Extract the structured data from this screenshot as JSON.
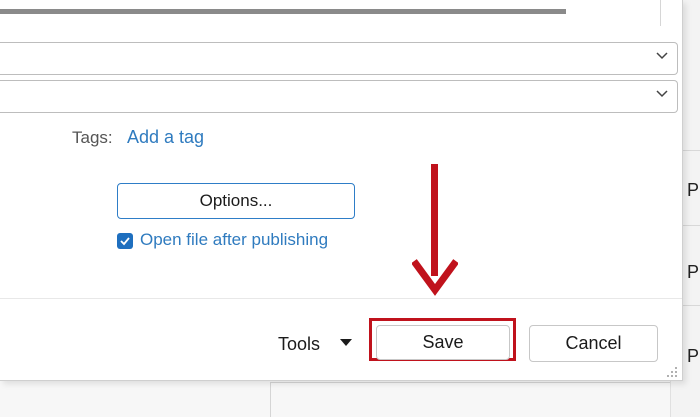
{
  "dialog": {
    "tags": {
      "label": "Tags:",
      "link": "Add a tag"
    },
    "options_button": "Options...",
    "open_after_publishing": {
      "label": "Open file after publishing",
      "checked": true
    },
    "footer": {
      "tools_label": "Tools",
      "save_label": "Save",
      "cancel_label": "Cancel"
    }
  },
  "background": {
    "right_column_chars": [
      "P",
      "P",
      "P"
    ]
  },
  "colors": {
    "accent": "#1e6fbf",
    "link": "#2f7bbf",
    "annotation_red": "#c0121c"
  },
  "icons": [
    "chevron-down-icon",
    "checkmark-icon",
    "dropdown-caret-icon",
    "down-arrow-annotation-icon",
    "resize-grip-icon"
  ]
}
